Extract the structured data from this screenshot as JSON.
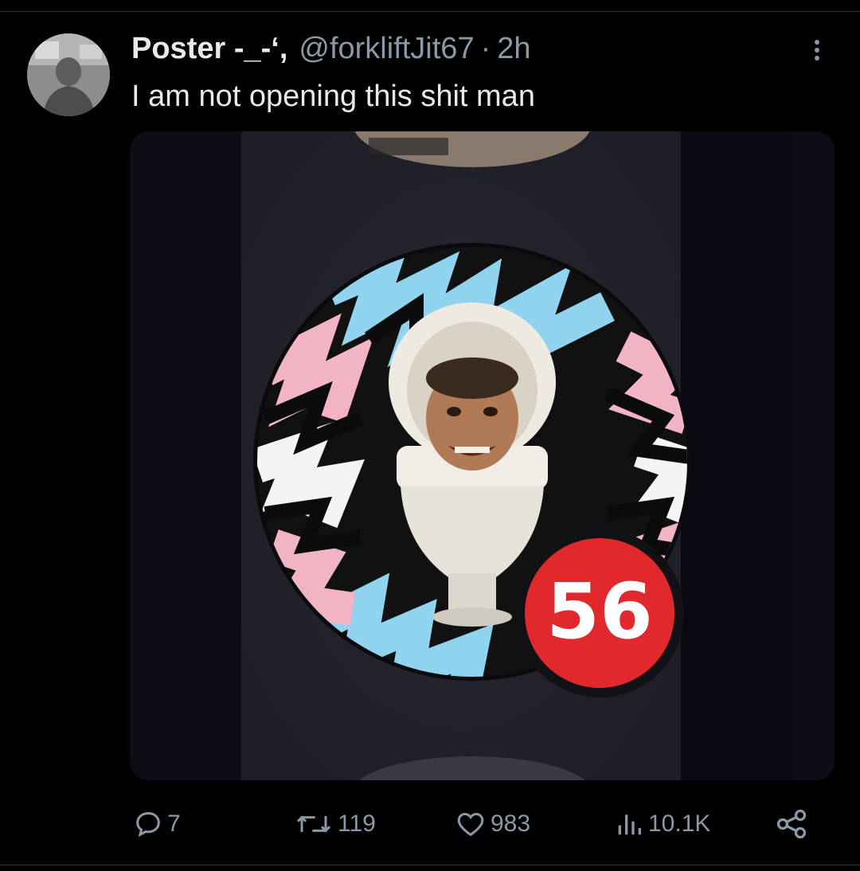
{
  "post": {
    "author": {
      "display_name": "Poster -_-‘,",
      "handle": "@forkliftJit67",
      "separator": "·",
      "time": "2h"
    },
    "text": "I am not opening this shit man",
    "media": {
      "badge_count": "56"
    }
  },
  "actions": {
    "reply_count": "7",
    "repost_count": "119",
    "like_count": "983",
    "views_count": "10.1K"
  },
  "icons": {
    "more": "more-options-icon",
    "reply": "reply-icon",
    "repost": "repost-icon",
    "like": "heart-icon",
    "views": "views-chart-icon",
    "share": "share-icon"
  },
  "colors": {
    "background": "#000000",
    "text_primary": "#e7e9ea",
    "text_secondary": "#8b98a5",
    "badge_red": "#e0282d",
    "pattern_blue": "#8fd3ef",
    "pattern_pink": "#f2b3c4"
  }
}
